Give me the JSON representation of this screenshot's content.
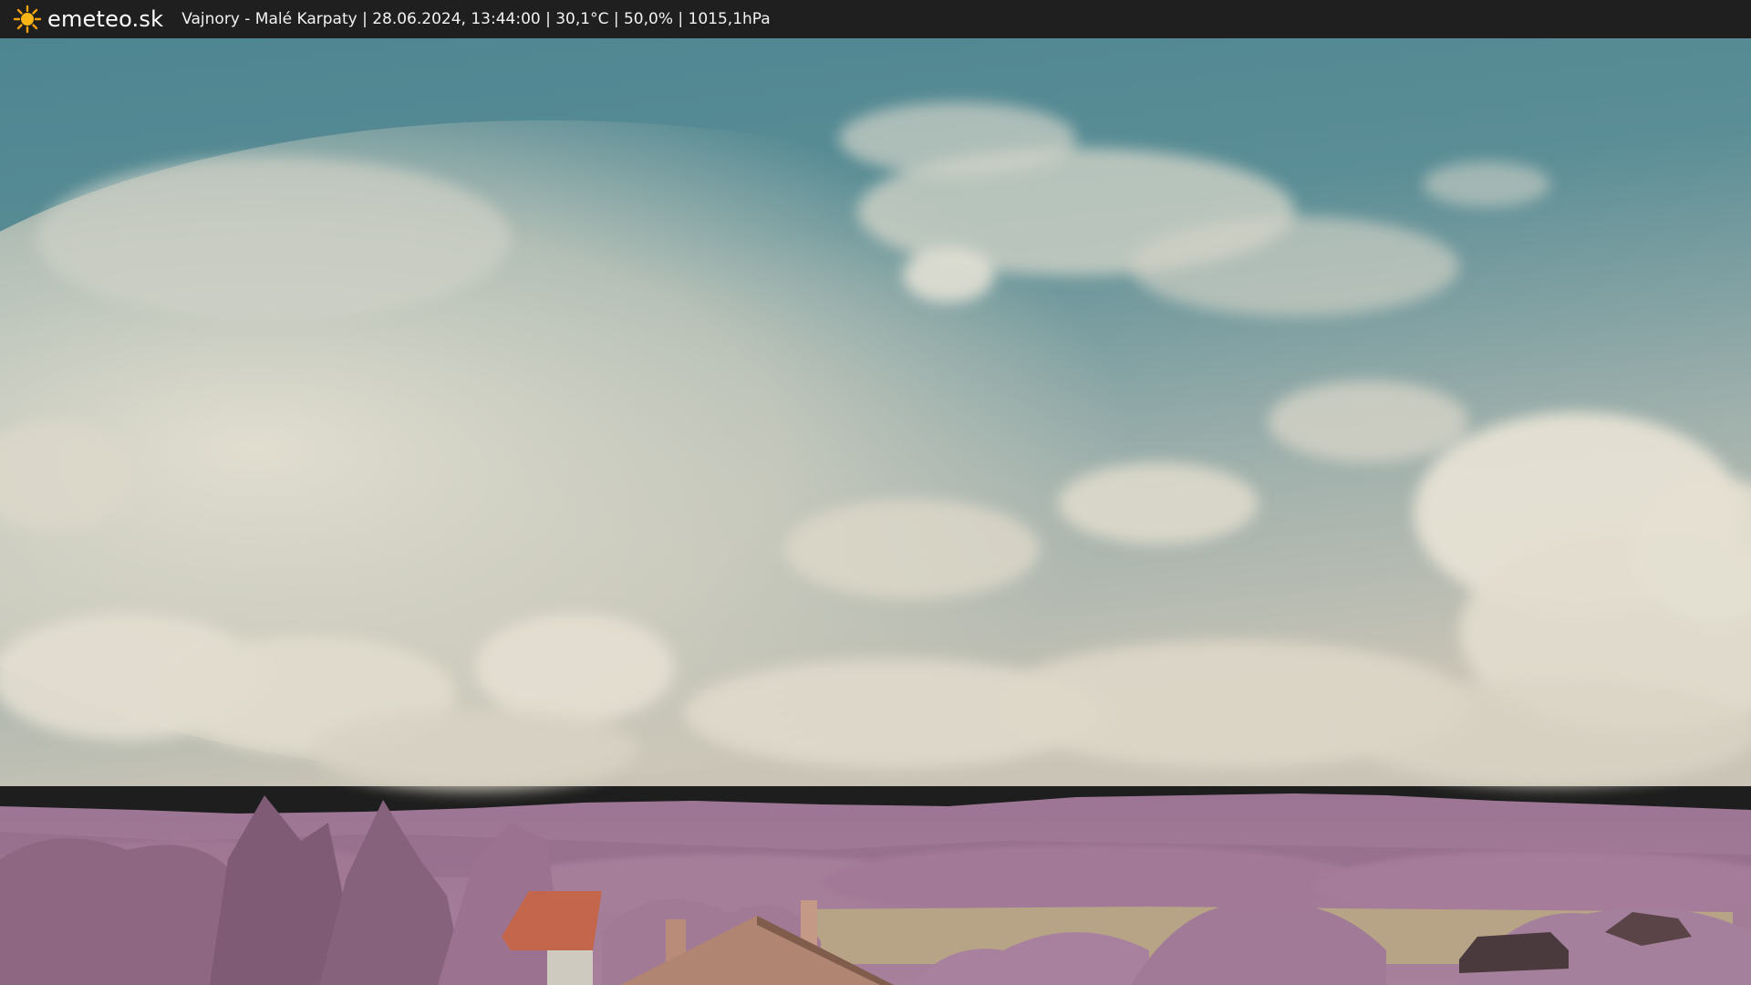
{
  "header": {
    "logo_text": "emeteo.sk",
    "logo_icon": "sun-icon",
    "caption": "Vajnory - Malé Karpaty | 28.06.2024, 13:44:00 | 30,1°C | 50,0% | 1015,1hPa"
  },
  "colors": {
    "bar": "#1f1f1f",
    "sky_top": "#3f7a88",
    "cloud": "#ddd8c8",
    "foliage": "#a37896",
    "roof": "#c0664a",
    "field": "#b6a182"
  }
}
